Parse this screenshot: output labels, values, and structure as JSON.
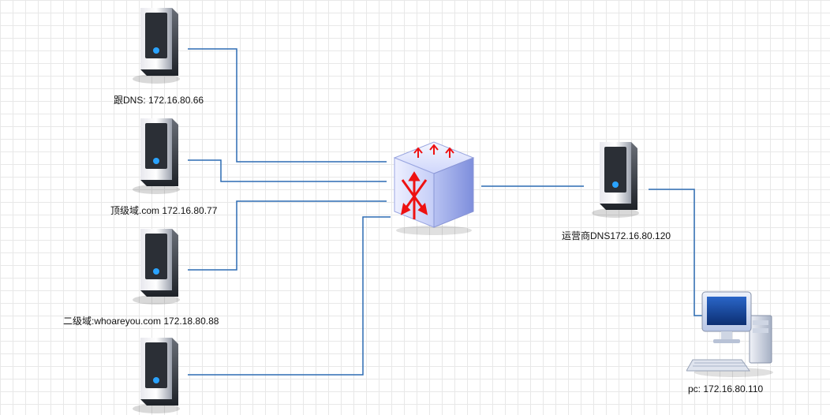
{
  "nodes": {
    "root_dns": {
      "label": "跟DNS: 172.16.80.66"
    },
    "tld_com": {
      "label": "顶级域.com 172.16.80.77"
    },
    "sld": {
      "label": "二级域:whoareyou.com 172.18.80.88"
    },
    "isp_dns": {
      "label": "运营商DNS172.16.80.120"
    },
    "pc": {
      "label": "pc: 172.16.80.110"
    }
  }
}
